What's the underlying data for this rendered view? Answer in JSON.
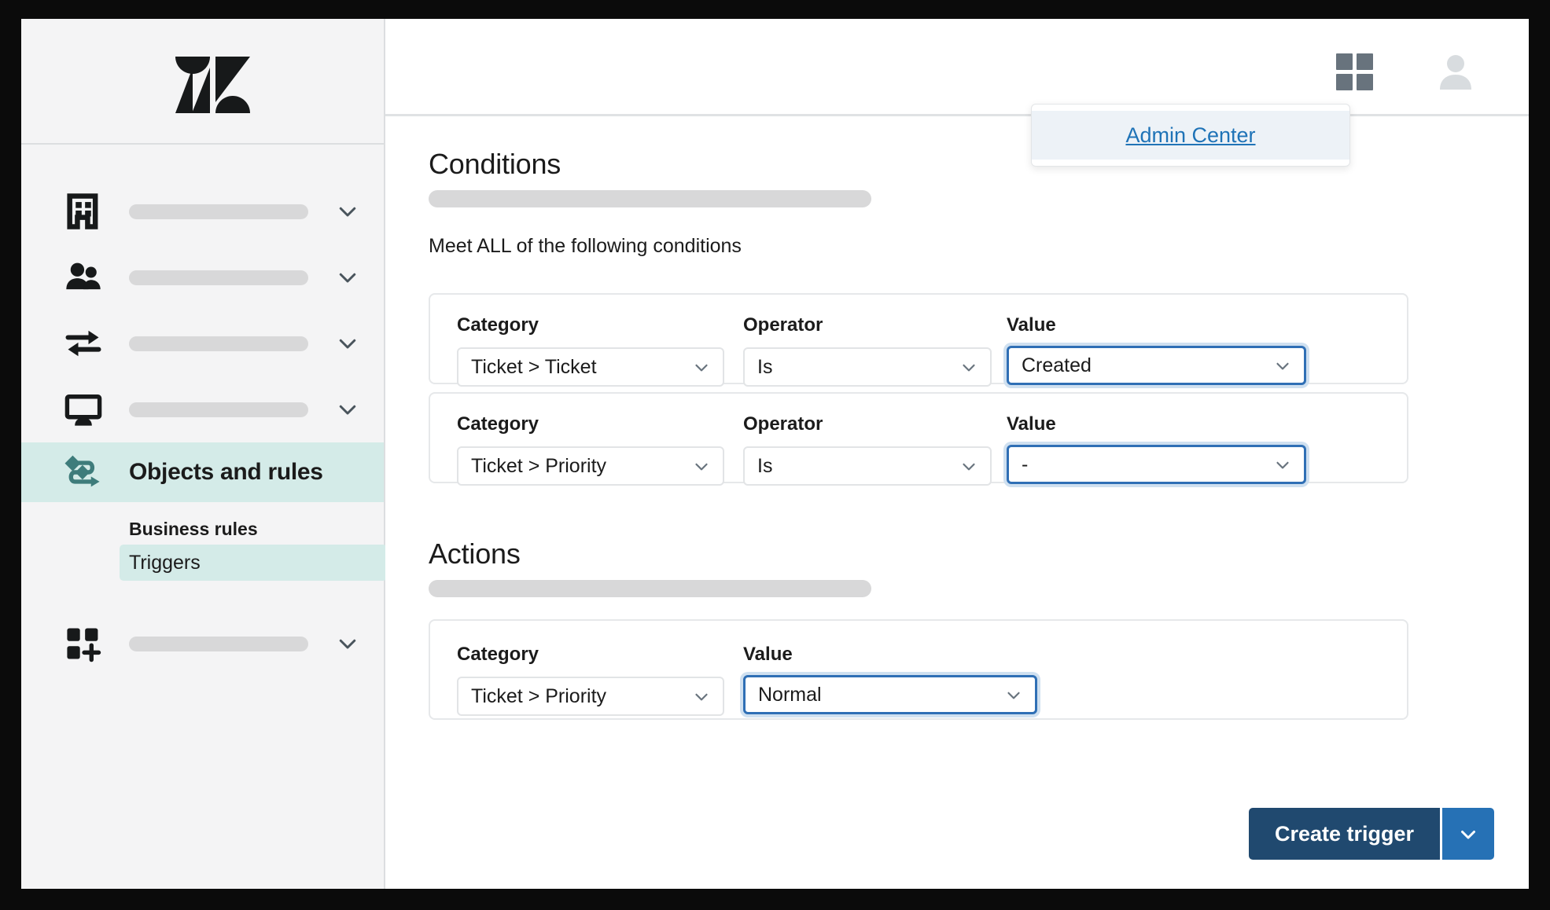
{
  "brand": {
    "logo_name": "zendesk-logo",
    "accent_teal": "#d4ebe8",
    "accent_blue": "#1f73b7",
    "primary_button": "#20496f",
    "focus_blue": "#2f6fb5"
  },
  "sidebar": {
    "nav_items": [
      {
        "icon": "building-icon",
        "label": "",
        "chevron": "chevron-down-icon"
      },
      {
        "icon": "people-icon",
        "label": "",
        "chevron": "chevron-down-icon"
      },
      {
        "icon": "transfer-arrows-icon",
        "label": "",
        "chevron": "chevron-down-icon"
      },
      {
        "icon": "display-monitor-icon",
        "label": "",
        "chevron": "chevron-down-icon"
      }
    ],
    "active_item": {
      "icon": "objects-rules-icon",
      "label": "Objects and rules"
    },
    "sub_section_heading": "Business rules",
    "sub_items": [
      {
        "label": "Triggers",
        "selected": true
      }
    ],
    "bottom_item": {
      "icon": "apps-add-icon",
      "label": "",
      "chevron": "chevron-down-icon"
    }
  },
  "header": {
    "grid_icon": "grid-apps-icon",
    "avatar_icon": "user-avatar-icon"
  },
  "dropdown": {
    "items": [
      {
        "label": "Admin Center",
        "highlighted": true
      }
    ]
  },
  "main": {
    "conditions": {
      "title": "Conditions",
      "subtitle": "Meet ALL of the following conditions",
      "rows": [
        {
          "category_label": "Category",
          "category_value": "Ticket > Ticket",
          "operator_label": "Operator",
          "operator_value": "Is",
          "value_label": "Value",
          "value_value": "Created",
          "value_focused": true
        },
        {
          "category_label": "Category",
          "category_value": "Ticket > Priority",
          "operator_label": "Operator",
          "operator_value": "Is",
          "value_label": "Value",
          "value_value": "-",
          "value_focused": true
        }
      ]
    },
    "actions": {
      "title": "Actions",
      "rows": [
        {
          "category_label": "Category",
          "category_value": "Ticket > Priority",
          "value_label": "Value",
          "value_value": "Normal",
          "value_focused": true
        }
      ]
    }
  },
  "footer": {
    "create_label": "Create trigger",
    "create_chevron": "chevron-down-icon"
  }
}
